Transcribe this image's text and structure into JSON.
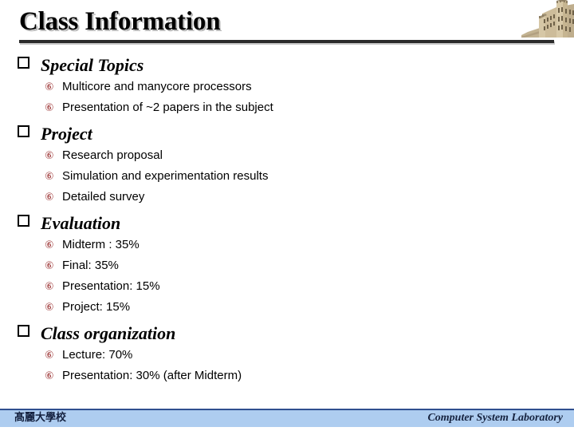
{
  "slide": {
    "title": "Class Information",
    "bullet_level1_glyph": "hollow-square",
    "bullet_level2_glyph": "⑥",
    "bullet_level2_color": "#9c3434",
    "header_photo_alt": "university-stone-building"
  },
  "sections": [
    {
      "heading": "Special Topics",
      "items": [
        "Multicore and manycore processors",
        "Presentation of ~2 papers in the subject"
      ]
    },
    {
      "heading": "Project",
      "items": [
        "Research proposal",
        "Simulation and experimentation results",
        "Detailed survey"
      ]
    },
    {
      "heading": "Evaluation",
      "items": [
        "Midterm : 35%",
        "Final: 35%",
        "Presentation: 15%",
        "Project: 15%"
      ]
    },
    {
      "heading": "Class organization",
      "items": [
        "Lecture: 70%",
        "Presentation: 30% (after Midterm)"
      ]
    }
  ],
  "footer": {
    "left": "髙麗大學校",
    "right": "Computer System Laboratory",
    "bar_color": "#aecdf0",
    "bar_border_color": "#2f4f8f"
  }
}
